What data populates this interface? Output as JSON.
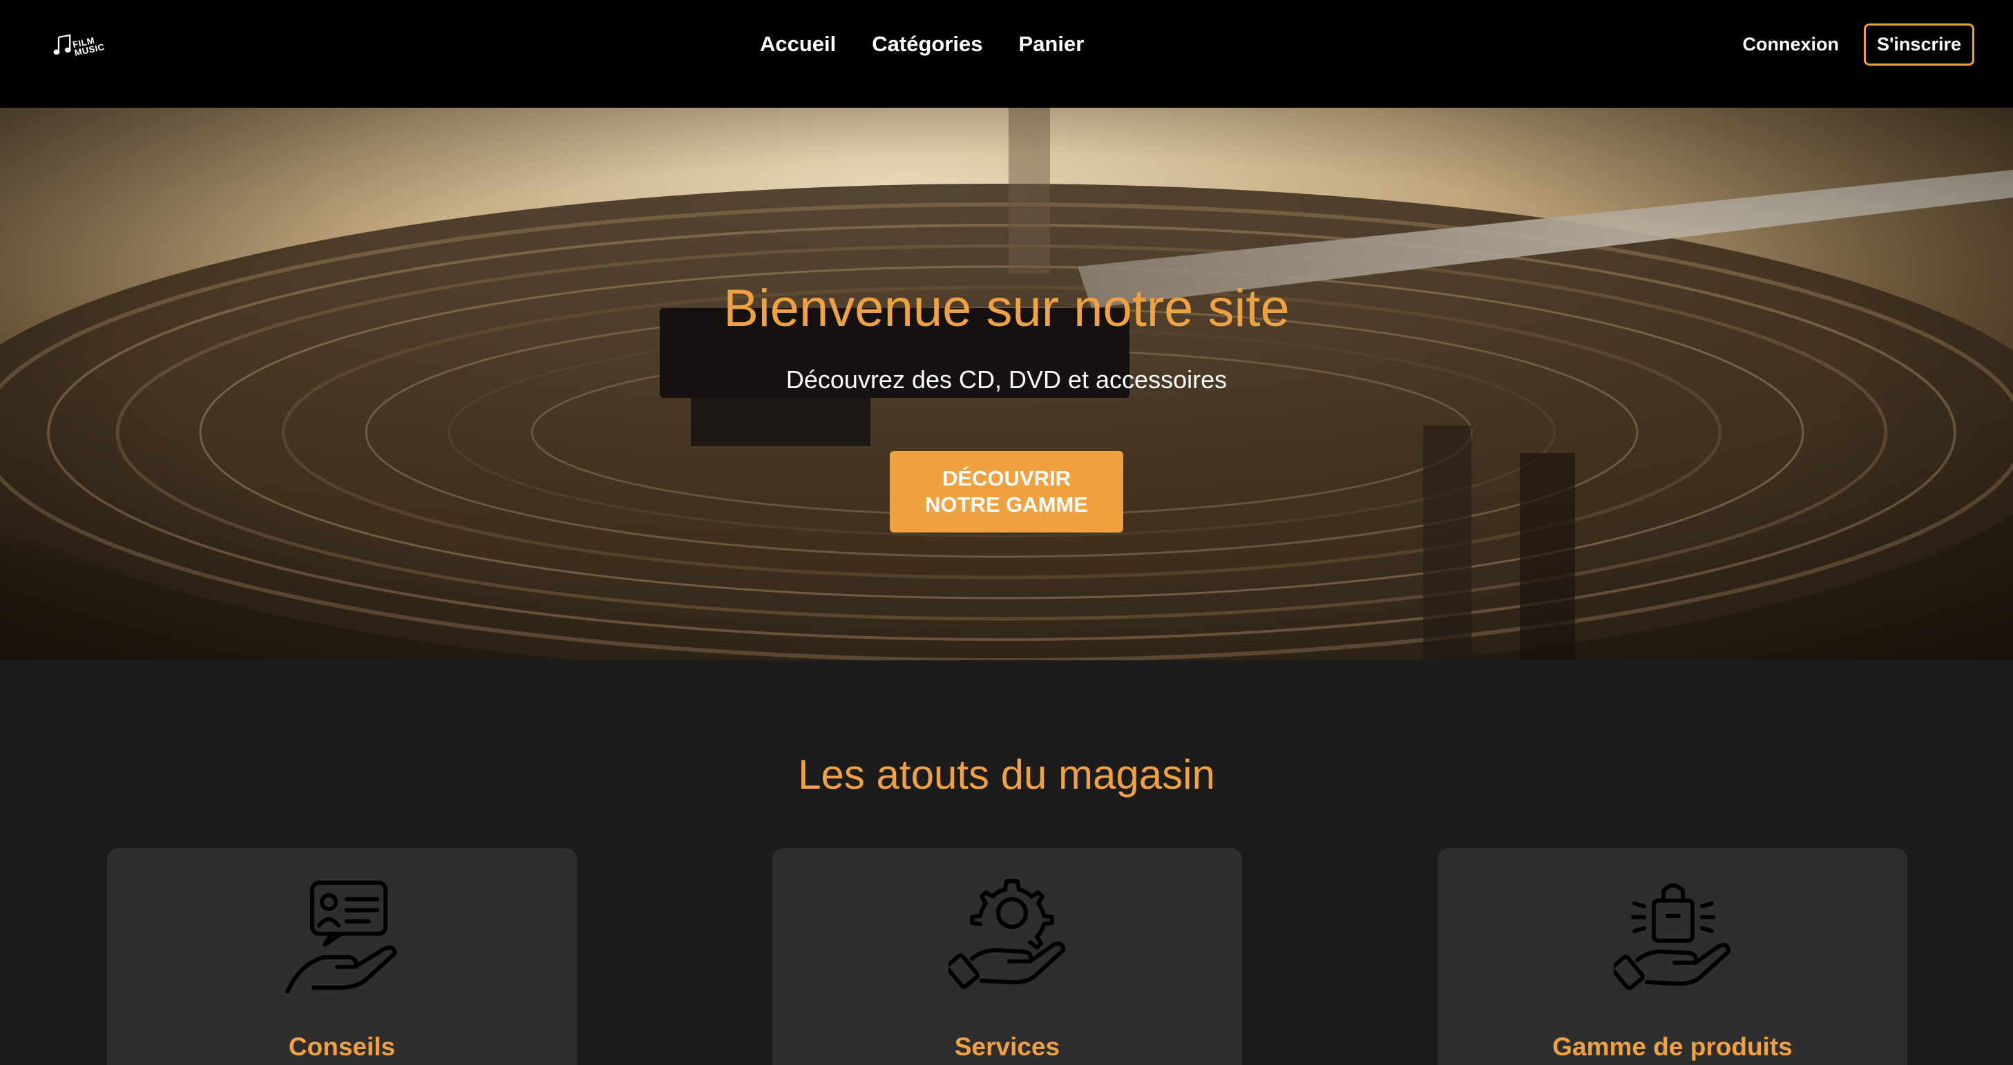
{
  "navbar": {
    "logo_text": "FILM MUSIC",
    "links": [
      {
        "label": "Accueil"
      },
      {
        "label": "Catégories"
      },
      {
        "label": "Panier"
      }
    ],
    "login_label": "Connexion",
    "signup_label": "S'inscrire"
  },
  "hero": {
    "title": "Bienvenue sur notre site",
    "subtitle": "Découvrez des CD, DVD et accessoires",
    "cta_label": "Découvrir\nnotre gamme",
    "background": "turntable-vinyl-photo"
  },
  "features": {
    "title": "Les atouts du magasin",
    "cards": [
      {
        "title": "Conseils",
        "icon": "advice-hand-icon"
      },
      {
        "title": "Services",
        "icon": "service-gear-hand-icon"
      },
      {
        "title": "Gamme de produits",
        "icon": "product-bag-hand-icon"
      }
    ]
  },
  "colors": {
    "accent": "#f0a140",
    "nav_bg": "#000000",
    "page_bg": "#1c1c1c",
    "card_bg": "#2e2e2e"
  }
}
